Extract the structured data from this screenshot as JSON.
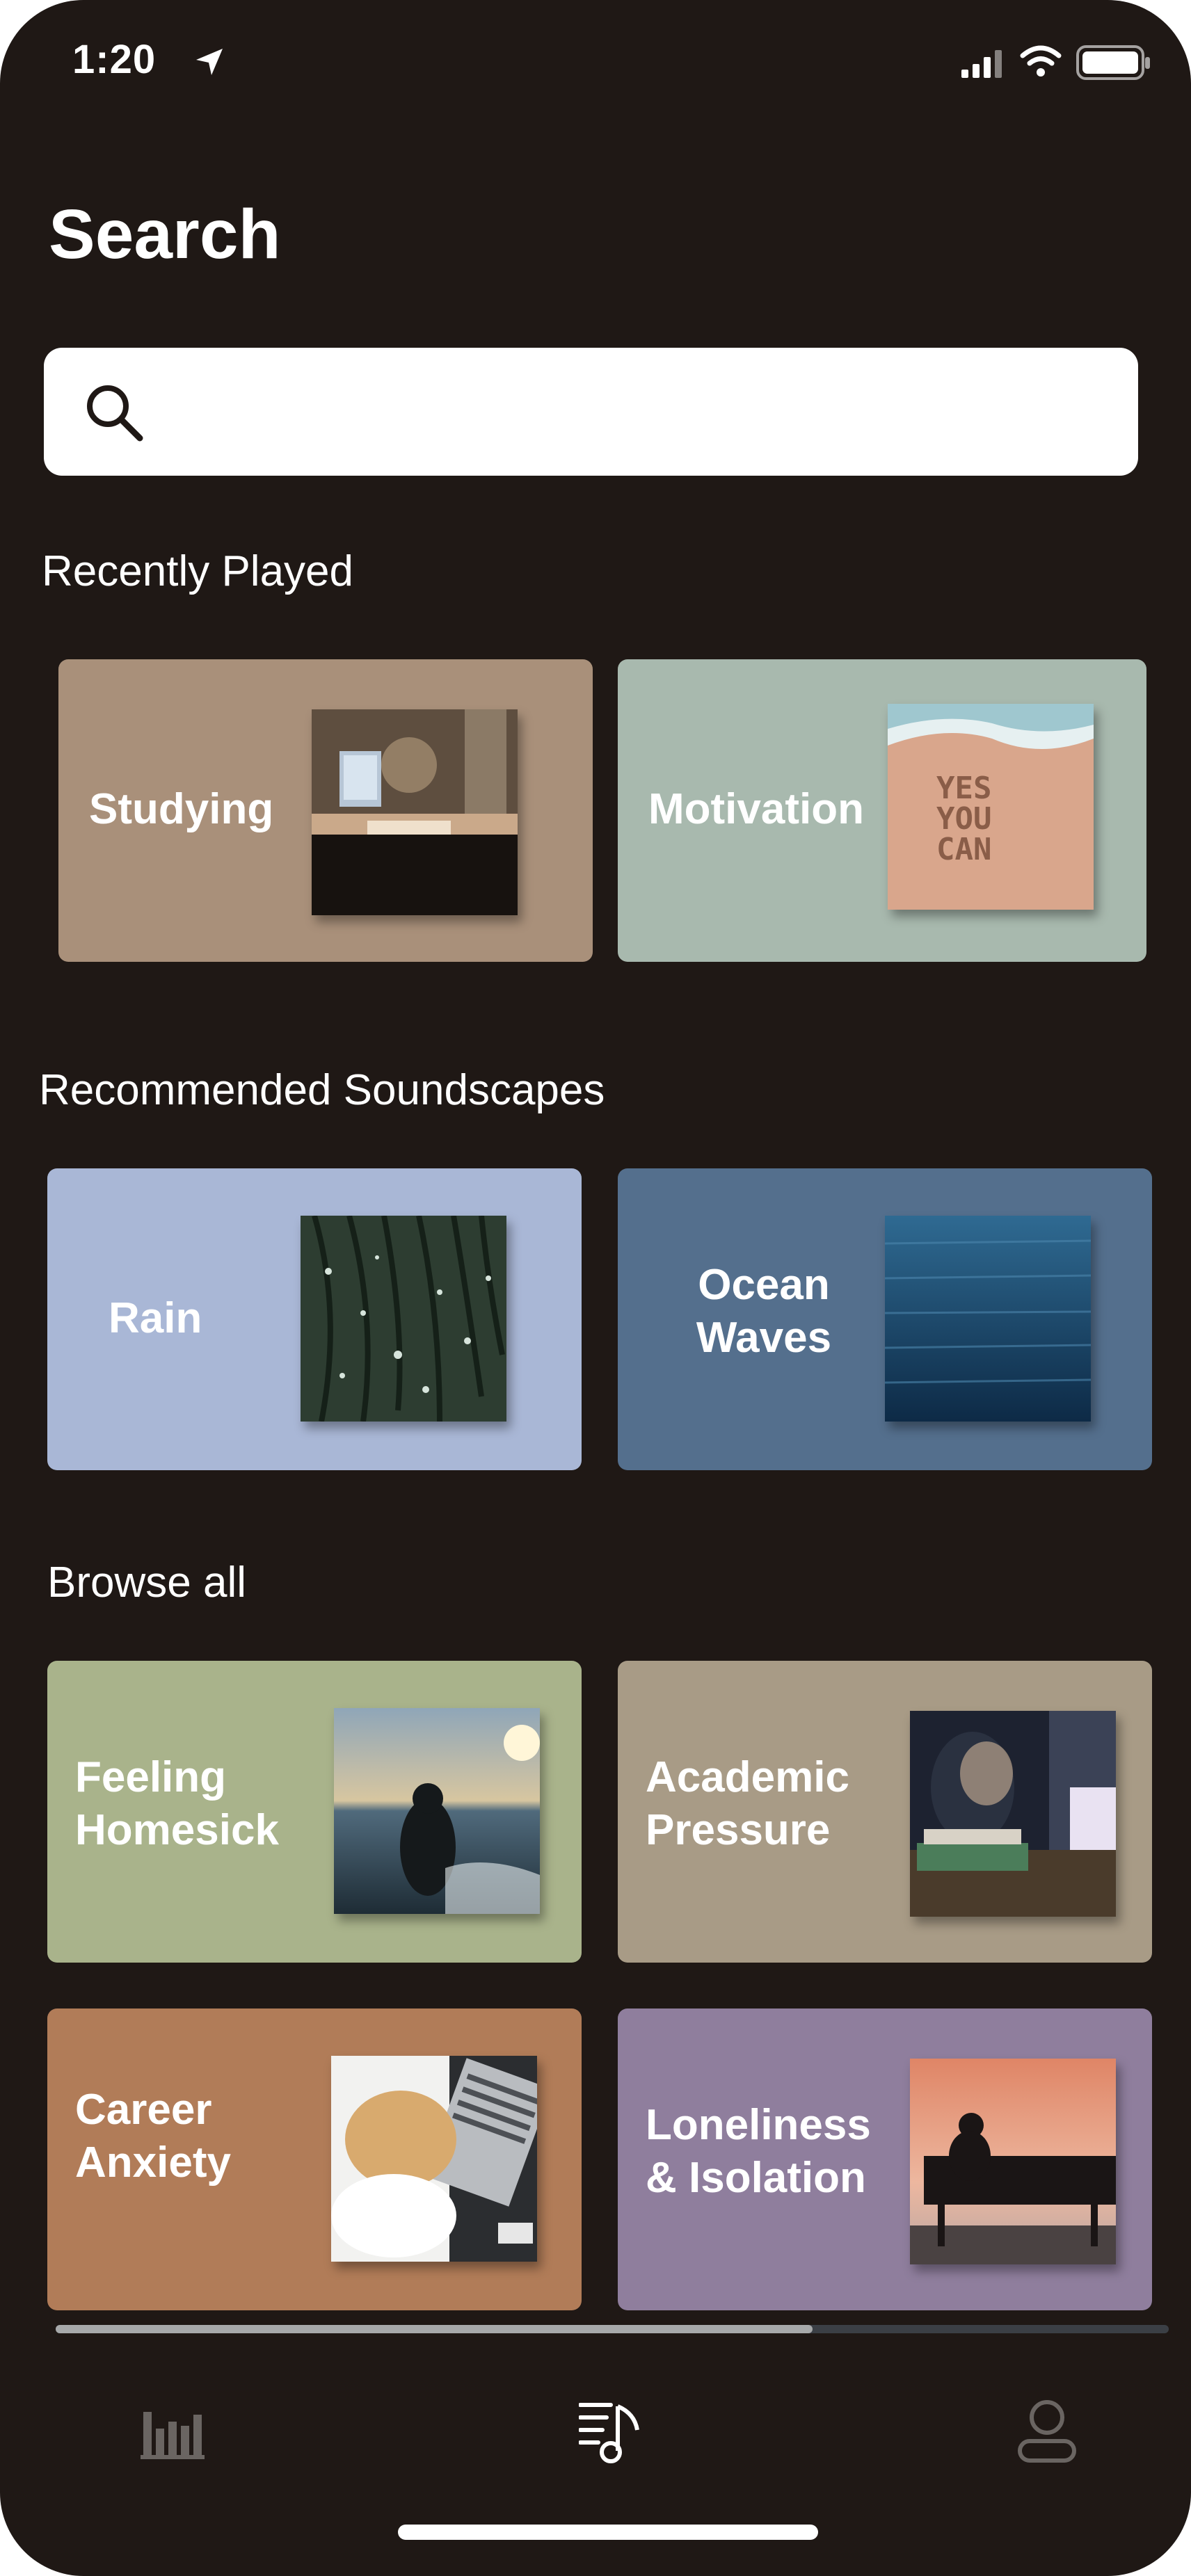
{
  "status_bar": {
    "time": "1:20"
  },
  "header": {
    "title": "Search"
  },
  "search": {
    "placeholder": "",
    "value": ""
  },
  "sections": {
    "recent": "Recently Played",
    "recommended": "Recommended Soundscapes",
    "browse": "Browse all"
  },
  "cards": {
    "studying": {
      "label": "Studying",
      "color": "#a9907a"
    },
    "motivation": {
      "label": "Motivation",
      "color": "#a8b9ae",
      "thumb_text": "YES\nYOU\nCAN"
    },
    "rain": {
      "label": "Rain",
      "color": "#a9b7d6"
    },
    "ocean": {
      "label": "Ocean\nWaves",
      "color": "#546f8d"
    },
    "homesick": {
      "label": "Feeling\nHomesick",
      "color": "#a9b38b"
    },
    "academic": {
      "label": "Academic\nPressure",
      "color": "#a89b86"
    },
    "career": {
      "label": "Career\nAnxiety",
      "color": "#b17c58"
    },
    "loneliness": {
      "label": "Loneliness\n& Isolation",
      "color": "#8f7e9d"
    }
  },
  "scroll": {
    "fraction": 0.68
  },
  "tab_bar": {
    "items": [
      {
        "icon": "bar-chart-icon",
        "active": false
      },
      {
        "icon": "music-list-icon",
        "active": true
      },
      {
        "icon": "profile-icon",
        "active": false
      }
    ]
  }
}
